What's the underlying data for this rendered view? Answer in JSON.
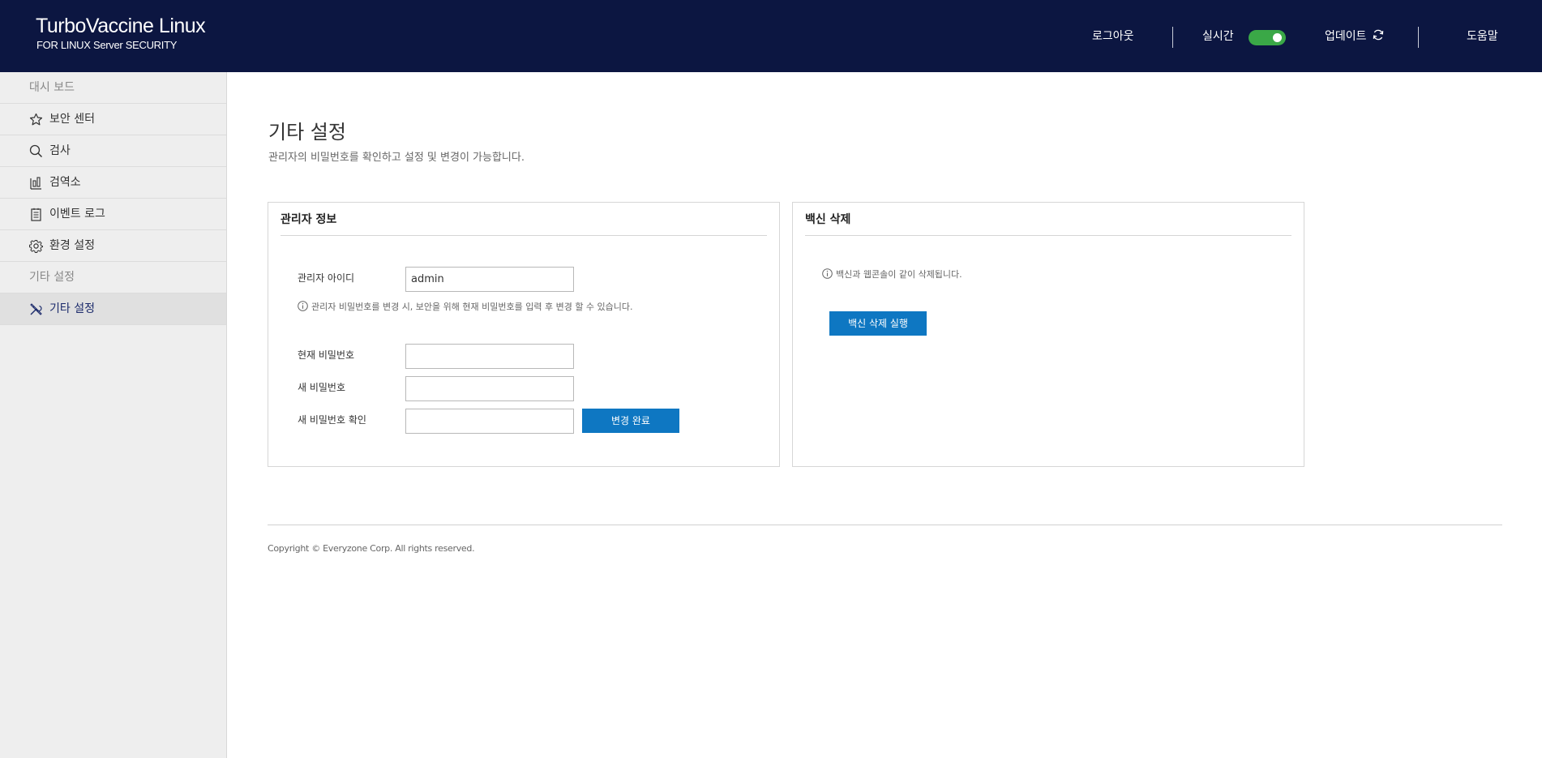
{
  "header": {
    "brand_title": "TurboVaccine Linux",
    "brand_subtitle": "FOR LINUX Server SECURITY",
    "logout": "로그아웃",
    "realtime": "실시간",
    "realtime_on": true,
    "update": "업데이트",
    "help": "도움말"
  },
  "sidebar": {
    "section_dashboard": "대시 보드",
    "items": [
      {
        "label": "보안 센터",
        "icon": "star-icon"
      },
      {
        "label": "검사",
        "icon": "search-icon"
      },
      {
        "label": "검역소",
        "icon": "quarantine-icon"
      },
      {
        "label": "이벤트 로그",
        "icon": "log-icon"
      },
      {
        "label": "환경 설정",
        "icon": "gear-icon"
      }
    ],
    "section_other": "기타 설정",
    "active_item": {
      "label": "기타 설정",
      "icon": "tools-icon"
    }
  },
  "main": {
    "title": "기타 설정",
    "description": "관리자의 비밀번호를 확인하고 설정 및 변경이 가능합니다."
  },
  "admin_card": {
    "title": "관리자 정보",
    "id_label": "관리자 아이디",
    "id_value": "admin",
    "hint": "관리자 비밀번호를 변경 시, 보안을 위해 현재 비밀번호를 입력 후 변경 할 수 있습니다.",
    "current_pw_label": "현재 비밀번호",
    "new_pw_label": "새 비밀번호",
    "confirm_pw_label": "새 비밀번호 확인",
    "submit_label": "변경 완료"
  },
  "uninstall_card": {
    "title": "백신 삭제",
    "hint": "백신과 웹콘솔이 같이 삭제됩니다.",
    "button_label": "백신 삭제 실행"
  },
  "footer": {
    "copyright": "Copyright © Everyzone Corp. All rights reserved."
  },
  "colors": {
    "header_bg": "#0c1641",
    "toggle_on": "#3aa847",
    "primary_button": "#0e77c2",
    "sidebar_bg": "#eeeeee"
  }
}
